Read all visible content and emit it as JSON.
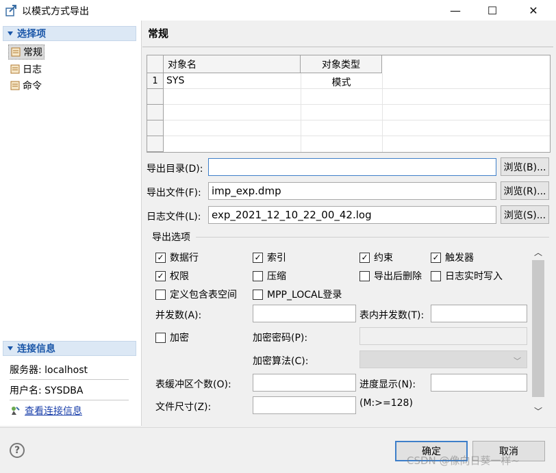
{
  "window": {
    "title": "以模式方式导出",
    "minimize": "—",
    "maximize": "☐",
    "close": "✕"
  },
  "sidebar": {
    "section_title": "选择项",
    "items": [
      {
        "label": "常规",
        "selected": true
      },
      {
        "label": "日志",
        "selected": false
      },
      {
        "label": "命令",
        "selected": false
      }
    ],
    "conn_section_title": "连接信息",
    "server": "服务器: localhost",
    "user": "用户名: SYSDBA",
    "view_conn_link": "查看连接信息"
  },
  "main": {
    "page_title": "常规",
    "table": {
      "headers": [
        "对象名",
        "对象类型"
      ],
      "rows": [
        {
          "num": "1",
          "name": "SYS",
          "type": "模式"
        }
      ]
    },
    "export_dir": {
      "label": "导出目录(D):",
      "value": "",
      "button": "浏览(B)..."
    },
    "export_file": {
      "label": "导出文件(F):",
      "value": "imp_exp.dmp",
      "button": "浏览(R)..."
    },
    "log_file": {
      "label": "日志文件(L):",
      "value": "exp_2021_12_10_22_00_42.log",
      "button": "浏览(S)..."
    },
    "options": {
      "group_label": "导出选项",
      "checkboxes": [
        {
          "label": "数据行",
          "checked": true
        },
        {
          "label": "索引",
          "checked": true
        },
        {
          "label": "约束",
          "checked": true
        },
        {
          "label": "触发器",
          "checked": true
        },
        {
          "label": "权限",
          "checked": true
        },
        {
          "label": "压缩",
          "checked": false
        },
        {
          "label": "导出后删除",
          "checked": false
        },
        {
          "label": "日志实时写入",
          "checked": false
        },
        {
          "label": "定义包含表空间",
          "checked": false
        },
        {
          "label": "MPP_LOCAL登录",
          "checked": false
        },
        {
          "label": "加密",
          "checked": false
        }
      ],
      "parallel_label": "并发数(A):",
      "table_parallel_label": "表内并发数(T):",
      "encrypt_pwd_label": "加密密码(P):",
      "encrypt_alg_label": "加密算法(C):",
      "buffer_label": "表缓冲区个数(O):",
      "progress_label": "进度显示(N):",
      "file_size_label": "文件尺寸(Z):",
      "file_size_hint": "(M:>=128)"
    }
  },
  "footer": {
    "help": "?",
    "ok": "确定",
    "cancel": "取消",
    "watermark": "CSDN @像向日葵一样~"
  },
  "colors": {
    "accent": "#1a56a8",
    "focus_border": "#3d7ec9",
    "link": "#1a3faa"
  }
}
